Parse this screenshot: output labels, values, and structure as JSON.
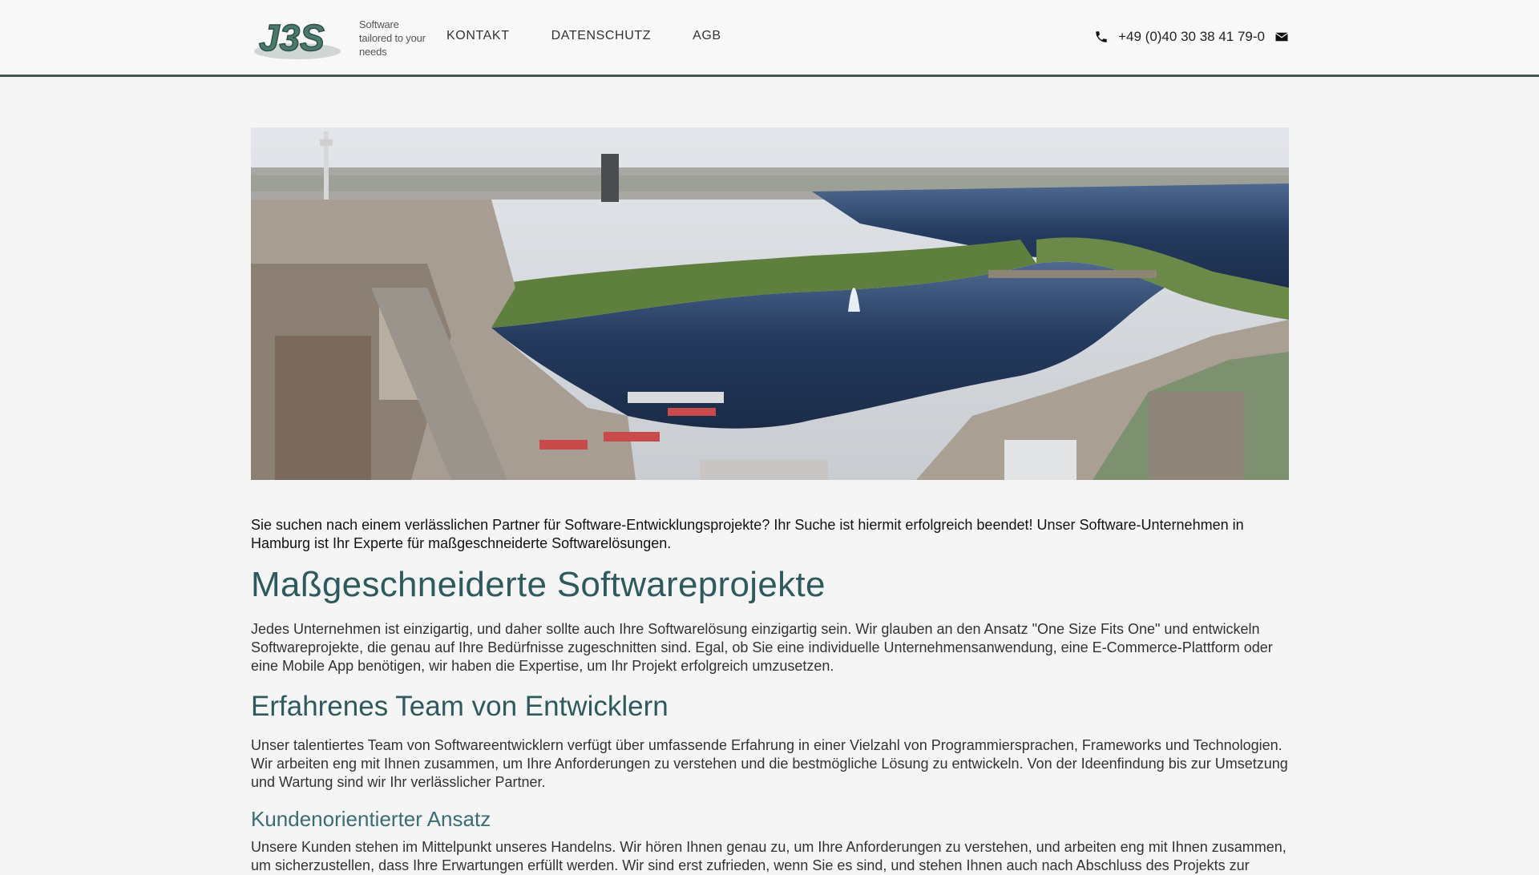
{
  "header": {
    "logo_text": "J3S",
    "tagline": [
      "Software",
      "tailored to your",
      "needs"
    ],
    "nav": [
      {
        "label": "KONTAKT"
      },
      {
        "label": "DATENSCHUTZ"
      },
      {
        "label": "AGB"
      }
    ],
    "phone": "+49 (0)40 30 38 41 79-0",
    "icons": {
      "phone": "phone-icon",
      "mail": "envelope-icon"
    }
  },
  "hero": {
    "image": "aerial-city-lake-photo",
    "colors": {
      "sky": "#d9dde3",
      "water": "#22365a",
      "buildings": "#b3aaa0",
      "trees": "#5f7f3e"
    }
  },
  "main": {
    "intro": "Sie suchen nach einem verlässlichen Partner für Software-Entwicklungsprojekte? Ihr Suche ist hiermit erfolgreich beendet! Unser Software-Unternehmen in Hamburg ist Ihr Experte für maßgeschneiderte Softwarelösungen.",
    "h1": "Maßgeschneiderte Softwareprojekte",
    "p1": "Jedes Unternehmen ist einzigartig, und daher sollte auch Ihre Softwarelösung einzigartig sein. Wir glauben an den Ansatz \"One Size Fits One\" und entwickeln Softwareprojekte, die genau auf Ihre Bedürfnisse zugeschnitten sind. Egal, ob Sie eine individuelle Unternehmensanwendung, eine E-Commerce-Plattform oder eine Mobile App benötigen, wir haben die Expertise, um Ihr Projekt erfolgreich umzusetzen.",
    "h2": "Erfahrenes Team von Entwicklern",
    "p2": "Unser talentiertes Team von Softwareentwicklern verfügt über umfassende Erfahrung in einer Vielzahl von Programmiersprachen, Frameworks und Technologien. Wir arbeiten eng mit Ihnen zusammen, um Ihre Anforderungen zu verstehen und die bestmögliche Lösung zu entwickeln. Von der Ideenfindung bis zur Umsetzung und Wartung sind wir Ihr verlässlicher Partner.",
    "h3": "Kundenorientierter Ansatz",
    "p3": "Unsere Kunden stehen im Mittelpunkt unseres Handelns. Wir hören Ihnen genau zu, um Ihre Anforderungen zu verstehen, und arbeiten eng mit Ihnen zusammen, um sicherzustellen, dass Ihre Erwartungen erfüllt werden. Wir sind erst zufrieden, wenn Sie es sind, und stehen Ihnen auch nach Abschluss des Projekts zur"
  },
  "colors": {
    "accent": "#2f5a5d",
    "header_border": "#3f5752",
    "background": "#f5f5f5"
  }
}
